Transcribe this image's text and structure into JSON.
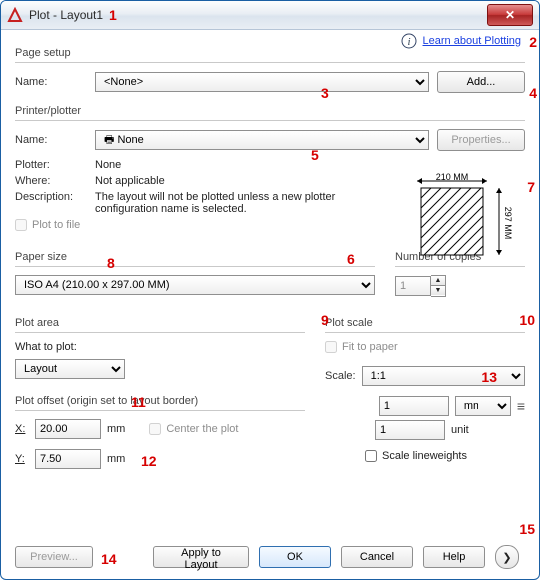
{
  "title": "Plot - Layout1",
  "learn_link": "Learn about Plotting",
  "pagesetup": {
    "group": "Page setup",
    "name_label": "Name:",
    "name_value": "<None>",
    "add_label": "Add..."
  },
  "printer": {
    "group": "Printer/plotter",
    "name_label": "Name:",
    "name_value": "None",
    "properties_label": "Properties...",
    "plotter_label": "Plotter:",
    "plotter_value": "None",
    "where_label": "Where:",
    "where_value": "Not applicable",
    "desc_label": "Description:",
    "desc_value": "The layout will not be plotted unless a new plotter configuration name is selected.",
    "plot_to_file_label": "Plot to file",
    "preview_w": "210 MM",
    "preview_h": "297 MM"
  },
  "papersize": {
    "group": "Paper size",
    "value": "ISO A4 (210.00 x 297.00 MM)"
  },
  "copies": {
    "group": "Number of copies",
    "value": "1"
  },
  "plotarea": {
    "group": "Plot area",
    "what_label": "What to plot:",
    "value": "Layout"
  },
  "plotscale": {
    "group": "Plot scale",
    "fit_label": "Fit to paper",
    "scale_label": "Scale:",
    "scale_value": "1:1",
    "num_value": "1",
    "unit_value": "mm",
    "den_value": "1",
    "den_unit": "unit",
    "lineweights_label": "Scale lineweights"
  },
  "plotoffset": {
    "group": "Plot offset (origin set to layout border)",
    "x_label": "X:",
    "x_value": "20.00",
    "y_label": "Y:",
    "y_value": "7.50",
    "unit": "mm",
    "center_label": "Center the plot"
  },
  "footer": {
    "preview": "Preview...",
    "apply": "Apply to Layout",
    "ok": "OK",
    "cancel": "Cancel",
    "help": "Help"
  },
  "annotations": {
    "a1": "1",
    "a2": "2",
    "a3": "3",
    "a4": "4",
    "a5": "5",
    "a6": "6",
    "a7": "7",
    "a8": "8",
    "a9": "9",
    "a10": "10",
    "a11": "11",
    "a12": "12",
    "a13": "13",
    "a14": "14",
    "a15": "15"
  }
}
